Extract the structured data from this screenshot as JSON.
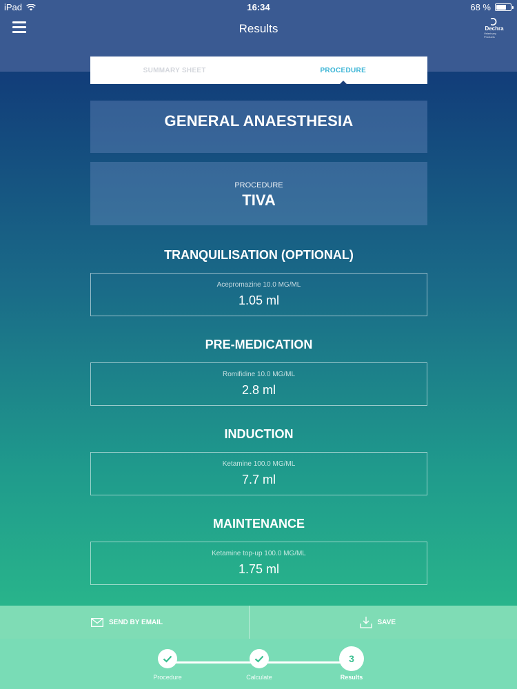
{
  "status_bar": {
    "device": "iPad",
    "time": "16:34",
    "battery": "68 %",
    "battery_level": 0.68
  },
  "header": {
    "title": "Results",
    "logo_text": "Dechra",
    "logo_sub": "Veterinary Products"
  },
  "tabs": [
    {
      "label": "SUMMARY SHEET",
      "active": false
    },
    {
      "label": "PROCEDURE",
      "active": true
    }
  ],
  "anaesthesia": {
    "title": "GENERAL ANAESTHESIA"
  },
  "procedure": {
    "label": "PROCEDURE",
    "value": "TIVA"
  },
  "sections": [
    {
      "title": "TRANQUILISATION (OPTIONAL)",
      "drug": "Acepromazine 10.0 MG/ML",
      "dose": "1.05 ml"
    },
    {
      "title": "PRE-MEDICATION",
      "drug": "Romifidine 10.0 MG/ML",
      "dose": "2.8 ml"
    },
    {
      "title": "INDUCTION",
      "drug": "Ketamine 100.0 MG/ML",
      "dose": "7.7 ml"
    },
    {
      "title": "MAINTENANCE",
      "drug": "Ketamine top-up 100.0 MG/ML",
      "dose": "1.75 ml"
    }
  ],
  "actions": {
    "email_label": "SEND BY EMAIL",
    "save_label": "SAVE"
  },
  "stepper": [
    {
      "label": "Procedure",
      "state": "done"
    },
    {
      "label": "Calculate",
      "state": "done"
    },
    {
      "label": "Results",
      "state": "current",
      "number": "3"
    }
  ],
  "colors": {
    "accent": "#3bb5d6",
    "step_current": "#3bbf91"
  }
}
